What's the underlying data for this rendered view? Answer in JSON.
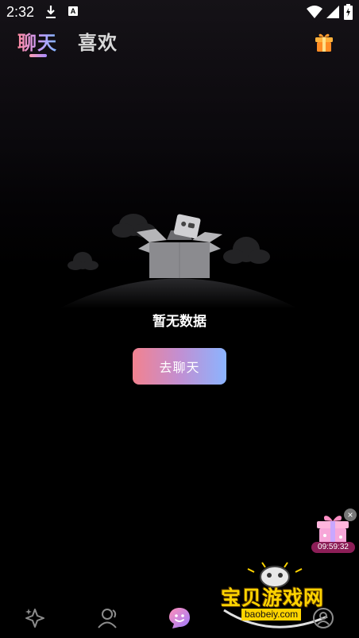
{
  "status_bar": {
    "time": "2:32",
    "download_icon": "download-icon",
    "notification_icon_letter": "A",
    "wifi_icon": "wifi-icon",
    "signal_icon": "signal-icon",
    "battery_icon": "battery-charging-icon"
  },
  "header": {
    "tabs": [
      {
        "label": "聊天",
        "active": true
      },
      {
        "label": "喜欢",
        "active": false
      }
    ],
    "gift_icon": "gift-icon"
  },
  "empty_state": {
    "message": "暂无数据",
    "illustration_icon": "empty-box-icon",
    "button_label": "去聊天"
  },
  "floating_gift": {
    "timer": "09:59:32",
    "close_label": "×"
  },
  "watermark": {
    "title": "宝贝游戏网",
    "url": "baobeiy.com"
  },
  "bottom_nav": {
    "items": [
      {
        "icon": "sparkle-icon",
        "active": false
      },
      {
        "icon": "people-icon",
        "active": false
      },
      {
        "icon": "chat-bubble-icon",
        "active": true
      },
      {
        "icon": "profile-icon",
        "active": false
      }
    ]
  },
  "colors": {
    "accent_pink": "#f2828f",
    "accent_purple": "#c28fd2",
    "accent_blue": "#8bb4ff",
    "watermark_yellow": "#ffd400"
  }
}
